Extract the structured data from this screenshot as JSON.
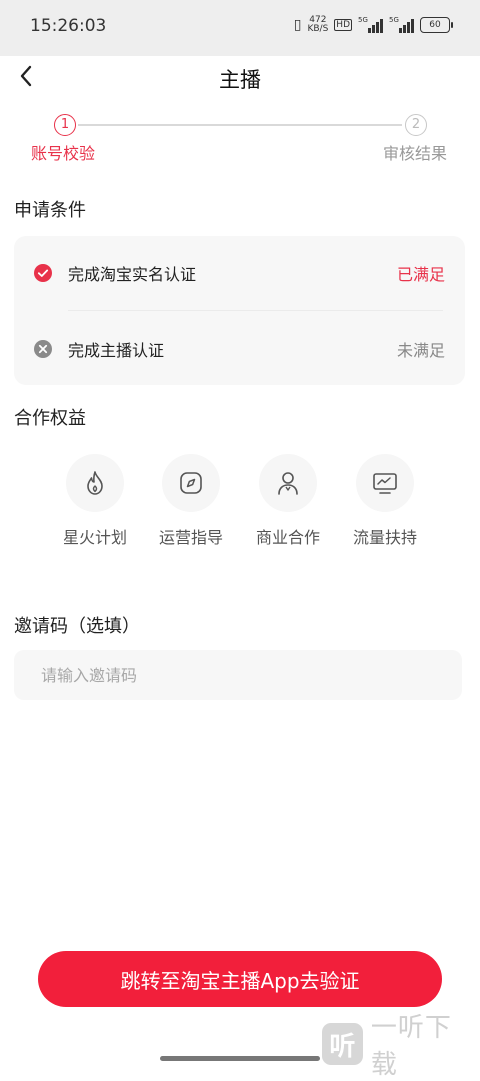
{
  "status_bar": {
    "time": "15:26:03",
    "net_speed": "472",
    "net_unit": "KB/S",
    "hd_label": "HD",
    "sig1_tag": "5G",
    "sig2_tag": "5G",
    "battery": "60"
  },
  "header": {
    "title": "主播",
    "back_icon": "chevron-left-icon"
  },
  "steps": [
    {
      "number": "1",
      "label": "账号校验",
      "state": "active"
    },
    {
      "number": "2",
      "label": "审核结果",
      "state": "pending"
    }
  ],
  "conditions": {
    "title": "申请条件",
    "items": [
      {
        "label": "完成淘宝实名认证",
        "status": "已满足",
        "icon": "check-circle-icon",
        "met": true
      },
      {
        "label": "完成主播认证",
        "status": "未满足",
        "icon": "x-circle-icon",
        "met": false
      }
    ]
  },
  "benefits": {
    "title": "合作权益",
    "items": [
      {
        "label": "星火计划",
        "icon": "flame-icon"
      },
      {
        "label": "运营指导",
        "icon": "compass-icon"
      },
      {
        "label": "商业合作",
        "icon": "person-icon"
      },
      {
        "label": "流量扶持",
        "icon": "trend-chart-icon"
      }
    ]
  },
  "invite": {
    "title": "邀请码（选填）",
    "placeholder": "请输入邀请码",
    "value": ""
  },
  "cta": {
    "label": "跳转至淘宝主播App去验证"
  },
  "watermark": {
    "logo": "听",
    "text": "一听下载"
  },
  "colors": {
    "accent": "#f21f3b",
    "met": "#e8324a",
    "unmet": "#888888"
  }
}
